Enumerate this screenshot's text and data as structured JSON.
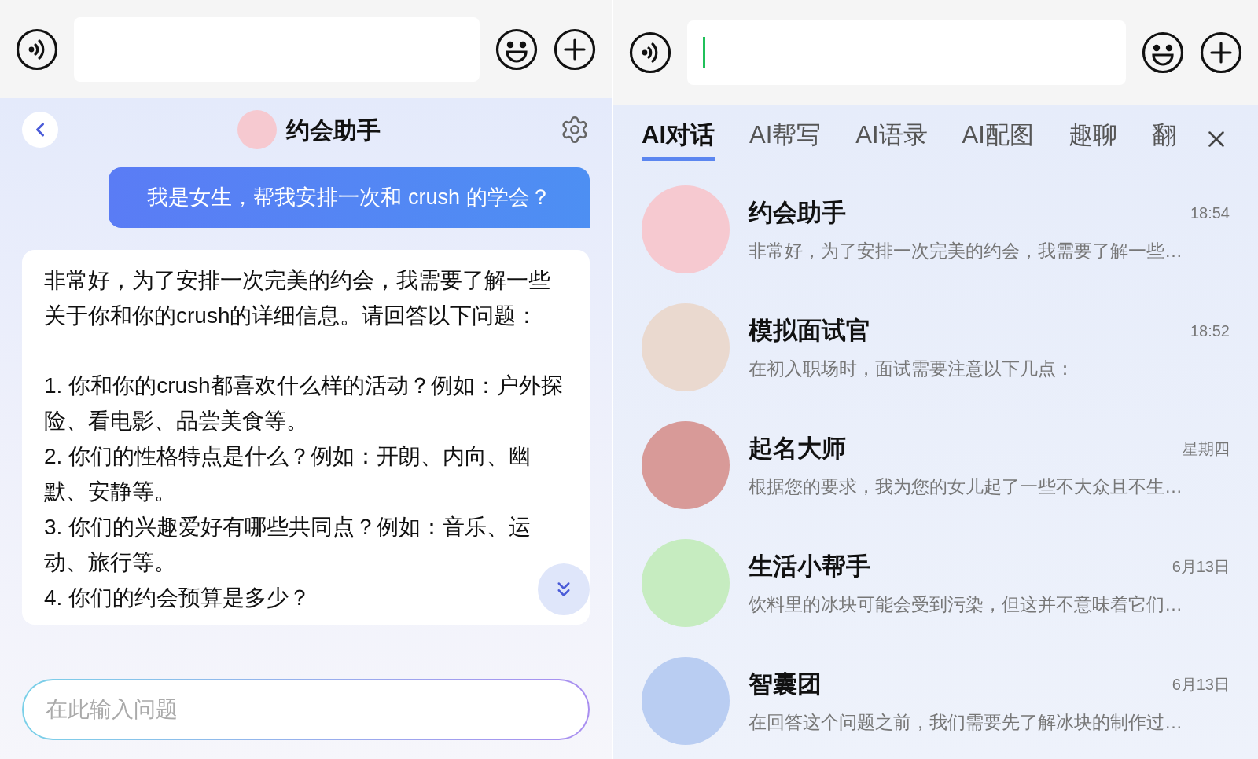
{
  "left": {
    "toolbar": {
      "input": {
        "focused": false
      }
    },
    "chat": {
      "title": "约会助手",
      "user_message": "我是女生，帮我安排一次和 crush 的学会？",
      "reply_intro": "非常好，为了安排一次完美的约会，我需要了解一些关于你和你的crush的详细信息。请回答以下问题：",
      "reply_items": [
        "1. 你和你的crush都喜欢什么样的活动？例如：户外探险、看电影、品尝美食等。",
        "2. 你们的性格特点是什么？例如：开朗、内向、幽默、安静等。",
        "3. 你们的兴趣爱好有哪些共同点？例如：音乐、运动、旅行等。",
        "4. 你们的约会预算是多少？"
      ],
      "input": {
        "placeholder": "在此输入问题"
      }
    }
  },
  "right": {
    "toolbar": {
      "input": {
        "focused": true
      }
    },
    "tabs": [
      {
        "label": "AI对话",
        "selected": true
      },
      {
        "label": "AI帮写",
        "selected": false
      },
      {
        "label": "AI语录",
        "selected": false
      },
      {
        "label": "AI配图",
        "selected": false
      },
      {
        "label": "趣聊",
        "selected": false
      },
      {
        "label": "翻",
        "selected": false
      }
    ],
    "conversations": [
      {
        "name": "约会助手",
        "time": "18:54",
        "preview": "非常好，为了安排一次完美的约会，我需要了解一些…",
        "color": "#f6c9d0"
      },
      {
        "name": "模拟面试官",
        "time": "18:52",
        "preview": "在初入职场时，面试需要注意以下几点：",
        "color": "#ead9cf"
      },
      {
        "name": "起名大师",
        "time": "星期四",
        "preview": "根据您的要求，我为您的女儿起了一些不大众且不生…",
        "color": "#d89a98"
      },
      {
        "name": "生活小帮手",
        "time": "6月13日",
        "preview": "饮料里的冰块可能会受到污染，但这并不意味着它们…",
        "color": "#c6ecc0"
      },
      {
        "name": "智囊团",
        "time": "6月13日",
        "preview": "在回答这个问题之前，我们需要先了解冰块的制作过…",
        "color": "#b9cdf2"
      }
    ]
  }
}
